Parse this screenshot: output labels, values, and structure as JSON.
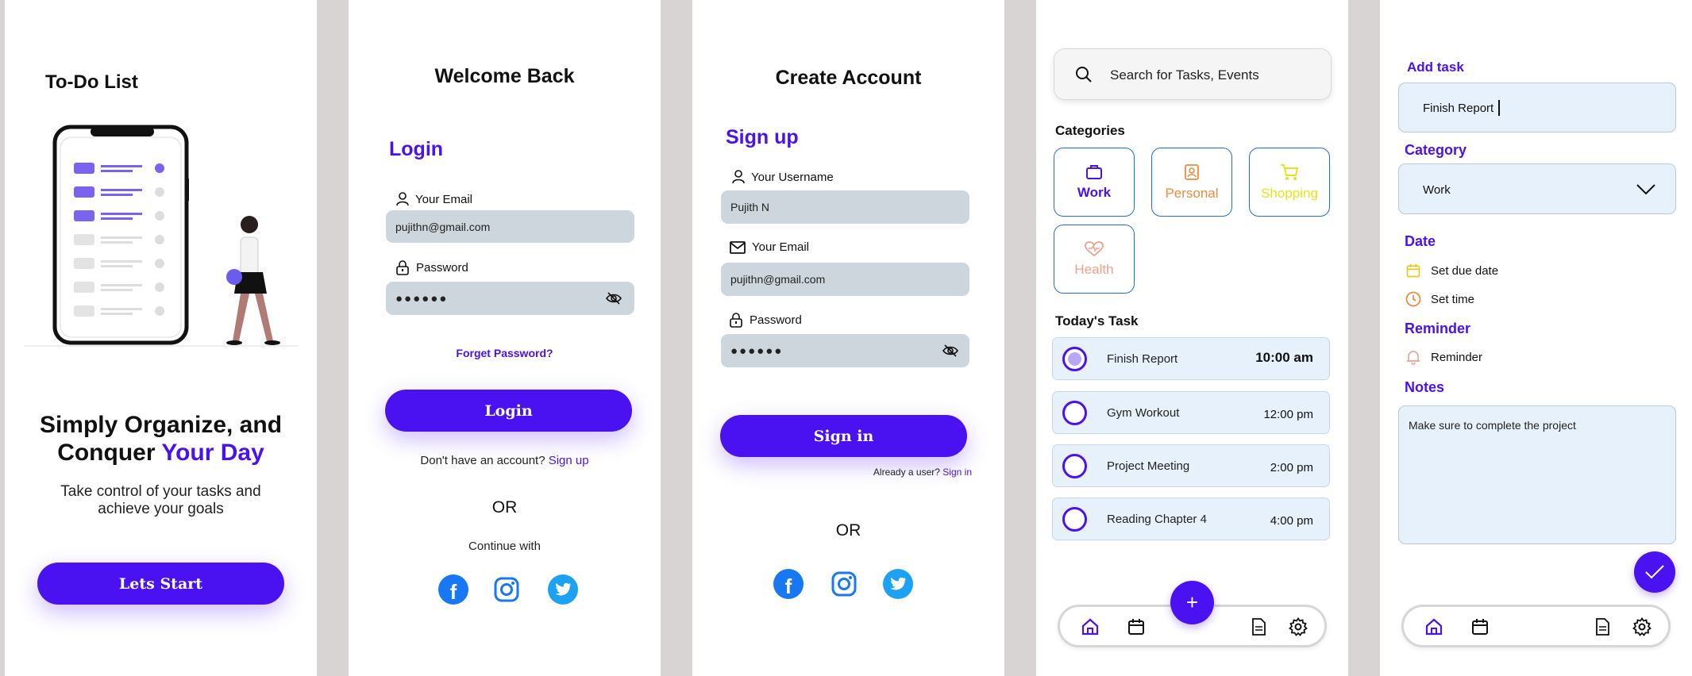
{
  "screen1": {
    "title": "To-Do List",
    "headline_part1": "Simply Organize,  and",
    "headline_part2": "Conquer ",
    "headline_accent": "Your Day",
    "subtitle_line1": "Take control of your tasks and",
    "subtitle_line2": "achieve your goals",
    "cta_label": "Lets Start"
  },
  "screen2": {
    "title": "Welcome Back",
    "section": "Login",
    "email_label": "Your Email",
    "email_value": "pujithn@gmail.com",
    "password_label": "Password",
    "password_value": "●●●●●●",
    "forgot": "Forget Password?",
    "login_button": "Login",
    "no_account": "Don't have an  account? ",
    "signup_link": "Sign up",
    "or": "OR",
    "continue_with": "Continue with"
  },
  "screen3": {
    "title": "Create Account",
    "section": "Sign up",
    "username_label": "Your Username",
    "username_value": "Pujith N",
    "email_label": "Your Email",
    "email_value": "pujithn@gmail.com",
    "password_label": "Password",
    "password_value": "●●●●●●",
    "signin_button": "Sign in",
    "already_user": "Already a user?  ",
    "signin_link": "Sign in",
    "or": "OR"
  },
  "screen4": {
    "search_placeholder": "Search for Tasks, Events",
    "categories_heading": "Categories",
    "categories": [
      {
        "label": "Work",
        "color": "#4a12f0"
      },
      {
        "label": "Personal",
        "color": "#f08a3c"
      },
      {
        "label": "Shopping",
        "color": "#e8e21a"
      },
      {
        "label": "Health",
        "color": "#f0a08a"
      }
    ],
    "today_heading": "Today's Task",
    "tasks": [
      {
        "name": "Finish Report",
        "time": "10:00 am"
      },
      {
        "name": "Gym Workout",
        "time": "12:00 pm"
      },
      {
        "name": "Project Meeting",
        "time": "2:00 pm"
      },
      {
        "name": "Reading Chapter 4",
        "time": "4:00 pm"
      }
    ],
    "fab": "+"
  },
  "screen5": {
    "add_task_heading": "Add task",
    "task_value": "Finish Report",
    "category_heading": "Category",
    "category_value": "Work",
    "date_heading": "Date",
    "set_due_date": "Set due date",
    "set_time": "Set time",
    "reminder_heading": "Reminder",
    "reminder_item": "Reminder",
    "notes_heading": "Notes",
    "notes_value": "Make sure to complete the project"
  },
  "colors": {
    "accent": "#4a12f0",
    "field": "#ccd6dc",
    "task_bg": "#e6f1fb",
    "facebook": "#1877f2",
    "twitter": "#1da1f2"
  }
}
